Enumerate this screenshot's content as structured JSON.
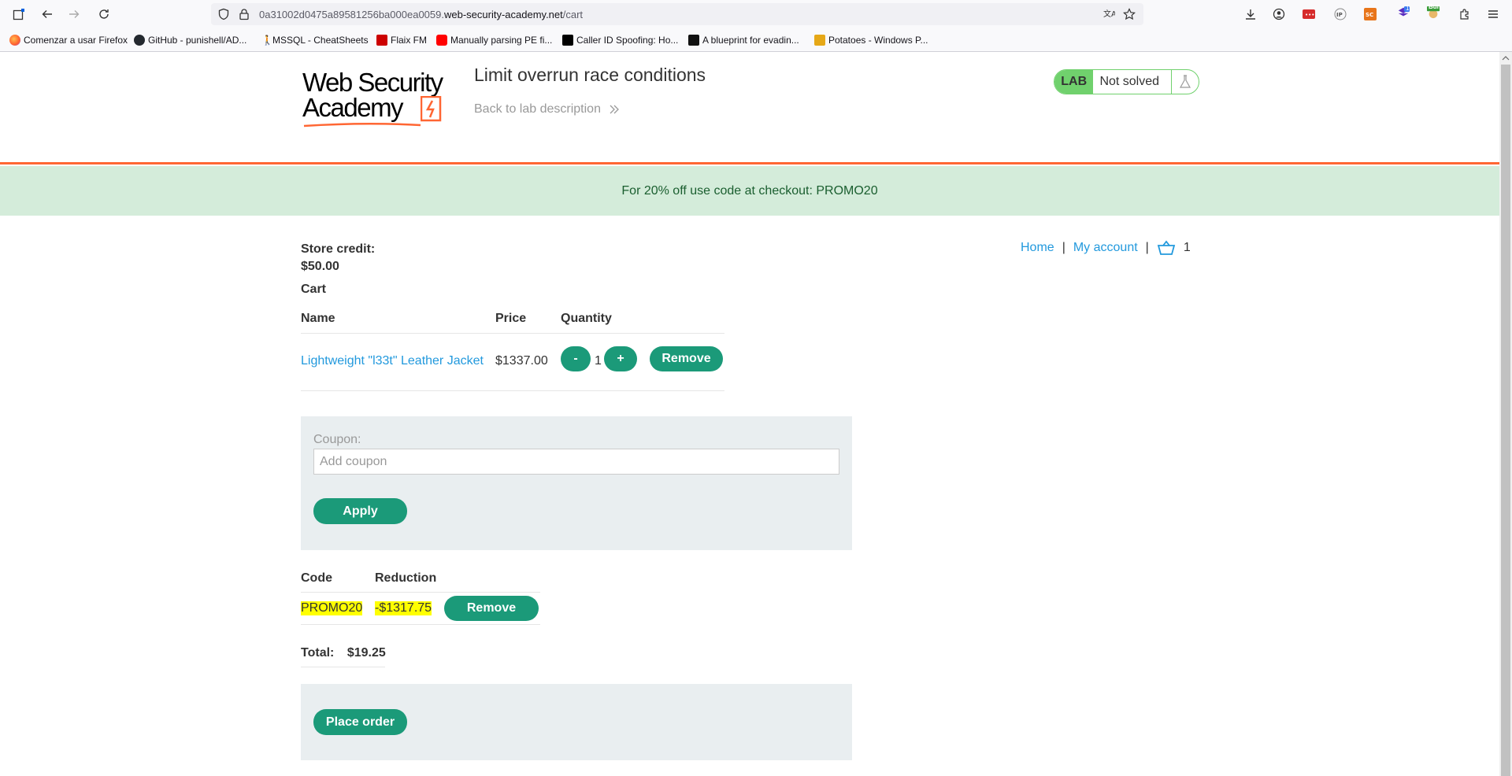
{
  "browser": {
    "url_prefix": "0a31002d0475a89581256ba000ea0059.",
    "url_host": "web-security-academy.net",
    "url_path": "/cart",
    "bookmarks": [
      "Comenzar a usar Firefox",
      "GitHub - punishell/AD...",
      "MSSQL - CheatSheets",
      "Flaix FM",
      "Manually parsing PE fi...",
      "Caller ID Spoofing: Ho...",
      "A blueprint for evadin...",
      "Potatoes - Windows P..."
    ],
    "ext_badge": "1",
    "ext_bun": "Bun"
  },
  "header": {
    "logo_line1": "Web Security",
    "logo_line2": "Academy",
    "lab_title": "Limit overrun race conditions",
    "back_link": "Back to lab description",
    "lab_label": "LAB",
    "lab_status": "Not solved"
  },
  "banner": {
    "text": "For 20% off use code at checkout: PROMO20"
  },
  "account": {
    "store_credit_label": "Store credit:",
    "store_credit_value": "$50.00",
    "cart_label": "Cart"
  },
  "nav": {
    "home": "Home",
    "my_account": "My account",
    "cart_count": "1",
    "sep": "|"
  },
  "cart": {
    "headers": [
      "Name",
      "Price",
      "Quantity"
    ],
    "items": [
      {
        "name": "Lightweight \"l33t\" Leather Jacket",
        "price": "$1337.00",
        "minus": "-",
        "quantity": "1",
        "plus": "+",
        "remove": "Remove"
      }
    ]
  },
  "coupon": {
    "label": "Coupon:",
    "placeholder": "Add coupon",
    "apply": "Apply"
  },
  "reductions": {
    "headers": [
      "Code",
      "Reduction"
    ],
    "rows": [
      {
        "code": "PROMO20",
        "reduction": "-$1317.75",
        "remove": "Remove"
      }
    ]
  },
  "total": {
    "label": "Total:",
    "value": "$19.25"
  },
  "order": {
    "place_order": "Place order"
  },
  "colors": {
    "accent": "#1b9a79",
    "orange": "#ff6633",
    "banner_bg": "#d4ecda",
    "link": "#2299dd",
    "lab_green": "#70d16d",
    "highlight": "#ffff00"
  }
}
